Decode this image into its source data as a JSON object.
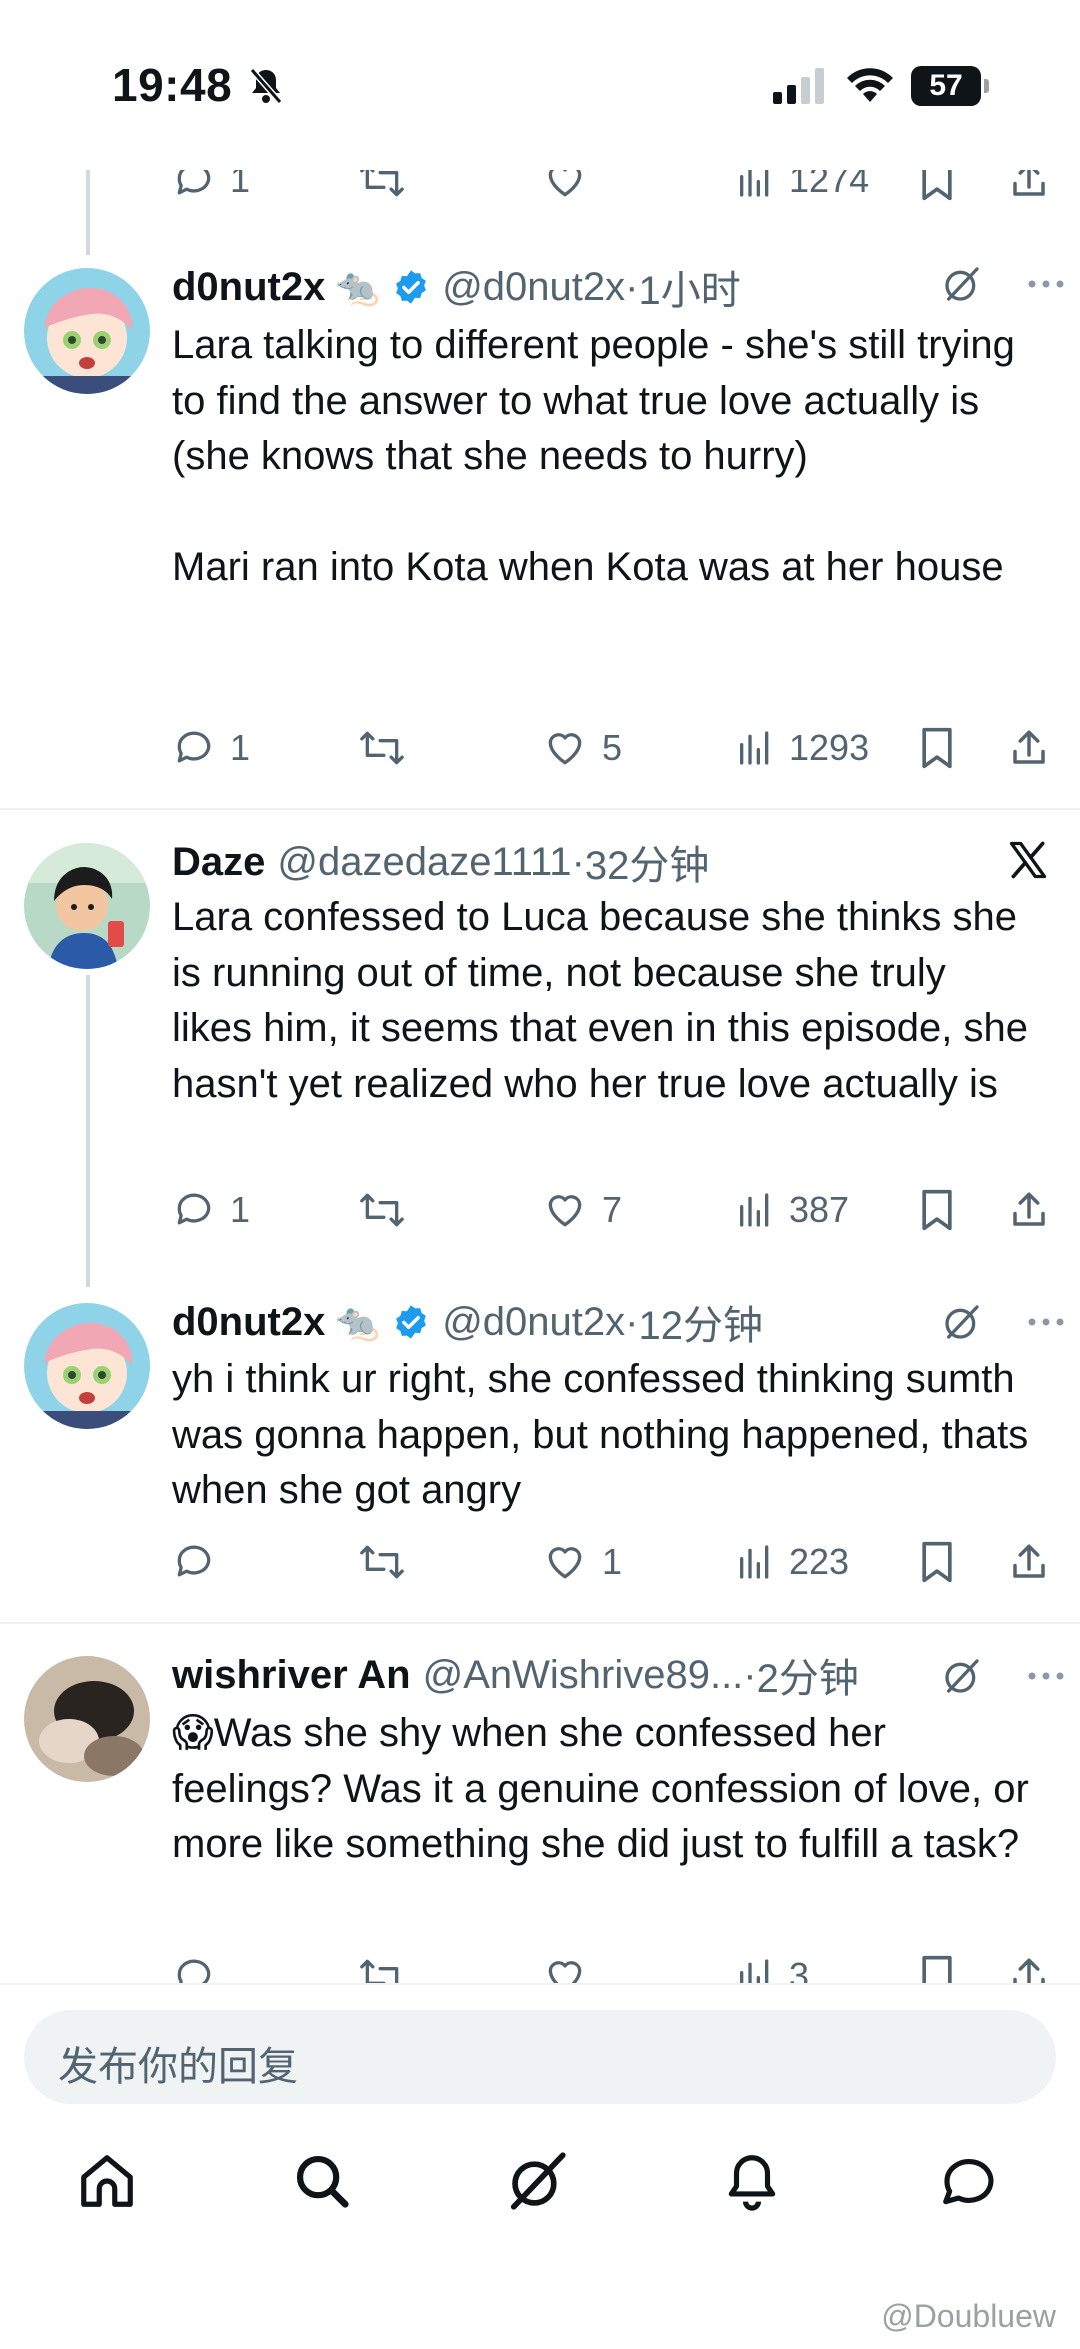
{
  "status_bar": {
    "time": "19:48",
    "battery": "57"
  },
  "top_partial": {
    "replies": "1",
    "views": "1274"
  },
  "tweets": [
    {
      "name": "d0nut2x",
      "emoji": "🐀",
      "handle": "@d0nut2x",
      "time": "1小时",
      "text": "Lara talking to different people - she's still trying to find the answer to what true love actually is (she knows that she needs to hurry)\n\nMari ran into Kota when Kota was at her house",
      "replies": "1",
      "likes": "5",
      "views": "1293"
    },
    {
      "name": "Daze",
      "handle": "@dazedaze1111",
      "time": "32分钟",
      "text": "Lara confessed to Luca because she thinks she is running out of time, not because she truly likes him, it seems that even in this episode, she hasn't yet realized who her true love actually is",
      "replies": "1",
      "likes": "7",
      "views": "387"
    },
    {
      "name": "d0nut2x",
      "emoji": "🐀",
      "handle": "@d0nut2x",
      "time": "12分钟",
      "text": "yh i think ur right, she confessed thinking sumth was gonna happen, but nothing happened, thats when she got angry",
      "replies": "",
      "likes": "1",
      "views": "223"
    },
    {
      "name": "wishriver An",
      "handle": "@AnWishrive89...",
      "time": "2分钟",
      "emoji": "😱",
      "text": "Was she shy when she confessed her feelings? Was it a genuine confession of love, or more like something she did just to fulfill a task?",
      "views": "3"
    }
  ],
  "composer": {
    "placeholder": "发布你的回复"
  },
  "watermark": "@Doubluew",
  "colors": {
    "text": "#0f1419",
    "secondary": "#536471",
    "verified": "#1d9bf0",
    "divider": "#eff3f4"
  }
}
